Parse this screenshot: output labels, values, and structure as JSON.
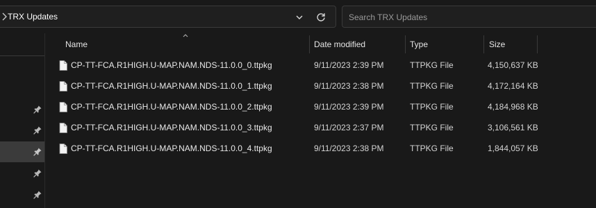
{
  "address": {
    "folder": "TRX Updates"
  },
  "search": {
    "placeholder": "Search TRX Updates"
  },
  "columns": {
    "name": "Name",
    "date": "Date modified",
    "type": "Type",
    "size": "Size"
  },
  "files": [
    {
      "name": "CP-TT-FCA.R1HIGH.U-MAP.NAM.NDS-11.0.0_0.ttpkg",
      "date": "9/11/2023 2:39 PM",
      "type": "TTPKG File",
      "size": "4,150,637 KB"
    },
    {
      "name": "CP-TT-FCA.R1HIGH.U-MAP.NAM.NDS-11.0.0_1.ttpkg",
      "date": "9/11/2023 2:38 PM",
      "type": "TTPKG File",
      "size": "4,172,164 KB"
    },
    {
      "name": "CP-TT-FCA.R1HIGH.U-MAP.NAM.NDS-11.0.0_2.ttpkg",
      "date": "9/11/2023 2:39 PM",
      "type": "TTPKG File",
      "size": "4,184,968 KB"
    },
    {
      "name": "CP-TT-FCA.R1HIGH.U-MAP.NAM.NDS-11.0.0_3.ttpkg",
      "date": "9/11/2023 2:37 PM",
      "type": "TTPKG File",
      "size": "3,106,561 KB"
    },
    {
      "name": "CP-TT-FCA.R1HIGH.U-MAP.NAM.NDS-11.0.0_4.ttpkg",
      "date": "9/11/2023 2:38 PM",
      "type": "TTPKG File",
      "size": "1,844,057 KB"
    }
  ],
  "icons": {
    "breadcrumb": "chevron-right-icon",
    "history": "chevron-down-icon",
    "refresh": "refresh-icon",
    "sort": "sort-ascending-icon",
    "pin": "pin-icon",
    "file": "file-icon"
  },
  "colors": {
    "background": "#191919",
    "selected_nav": "#3b3b3b",
    "border": "#3a3a3a",
    "text": "#e6e6e6"
  }
}
